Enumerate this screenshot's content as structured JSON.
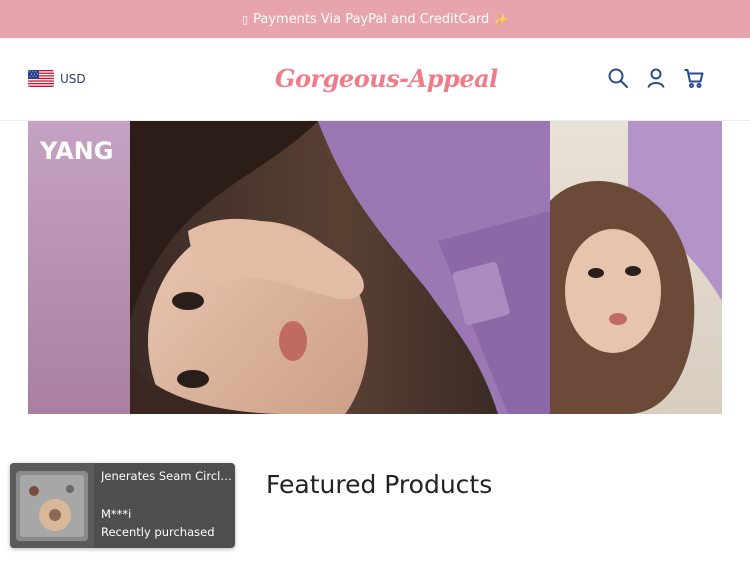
{
  "announcement": {
    "lead_glyph": "▯",
    "text": "Payments Via PayPal and CreditCard",
    "trail_glyph": "✨"
  },
  "header": {
    "currency": {
      "code": "USD",
      "icon": "us-flag-icon"
    },
    "logo_text": "Gorgeous-Appeal",
    "icons": [
      "search-icon",
      "account-icon",
      "cart-icon"
    ]
  },
  "hero": {
    "brand_text": "YANG",
    "label_text": "YANG"
  },
  "recent_purchase": {
    "product_name": "Jenerates Seam Circle Tool",
    "buyer": "M***i",
    "status": "Recently purchased"
  },
  "featured": {
    "title": "Featured Products"
  },
  "colors": {
    "announcement_bg": "#e8a4ad",
    "logo": "#f07c8a",
    "icon": "#2b4a8c",
    "popup_bg": "#4e4e4e"
  }
}
